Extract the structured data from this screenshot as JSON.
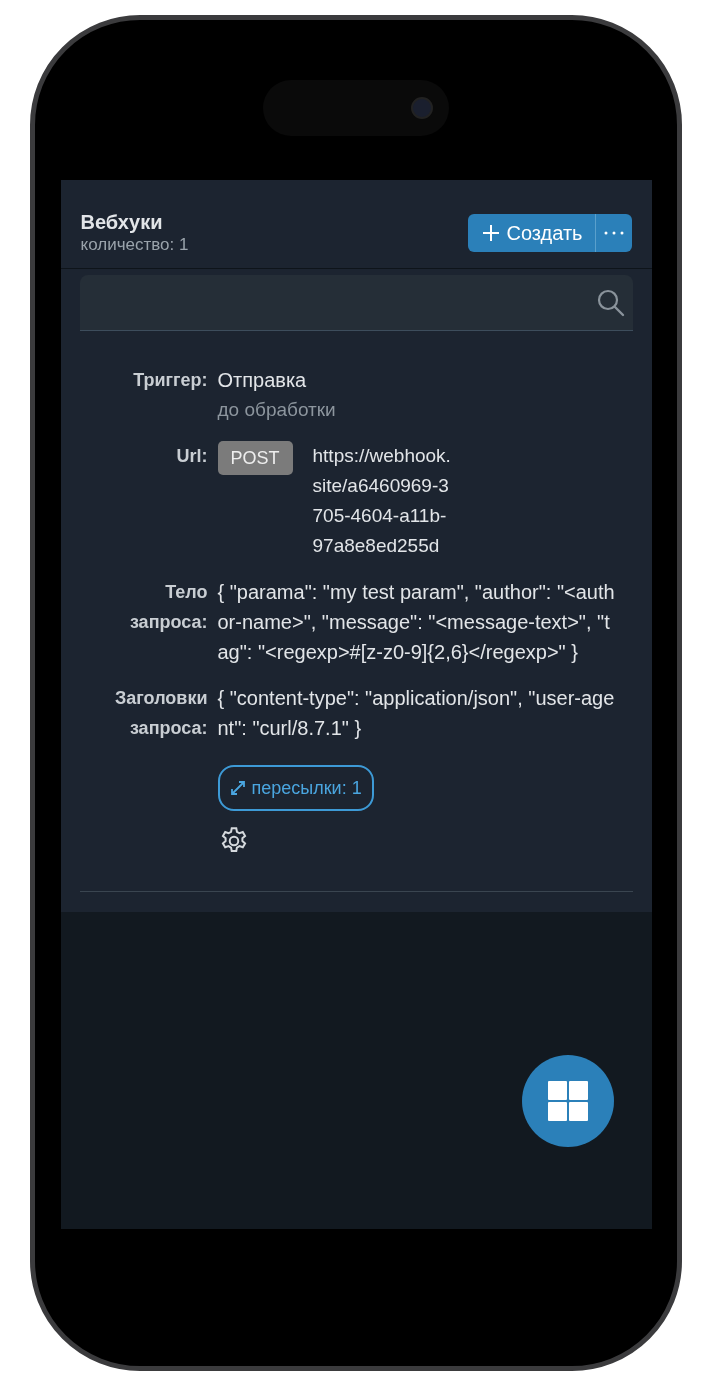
{
  "header": {
    "title": "Вебхуки",
    "count": "количество: 1",
    "create_button": "Создать"
  },
  "fields": [
    {
      "kind": "text",
      "label": "Триггер:",
      "value": "Отправка",
      "note": "до обработки"
    },
    {
      "kind": "url",
      "label": "Url:",
      "method": "POST",
      "value_lines": [
        "https://webhook.",
        "site/a6460969-3",
        "705-4604-a11b-",
        "97a8e8ed255d"
      ]
    },
    {
      "kind": "text",
      "label": "Тело запроса:",
      "value": "{ \"parama\": \"my test param\", \"author\": \"<author-name>\", \"message\": \"<message-text>\", \"tag\": \"<regexp>#[z-z0-9]{2,6}</regexp>\" }"
    },
    {
      "kind": "text",
      "label": "Заголовки запроса:",
      "value": "{ \"content-type\": \"application/json\", \"user-agent\": \"curl/8.7.1\" }"
    }
  ],
  "forwards_button": "пересылки: 1"
}
